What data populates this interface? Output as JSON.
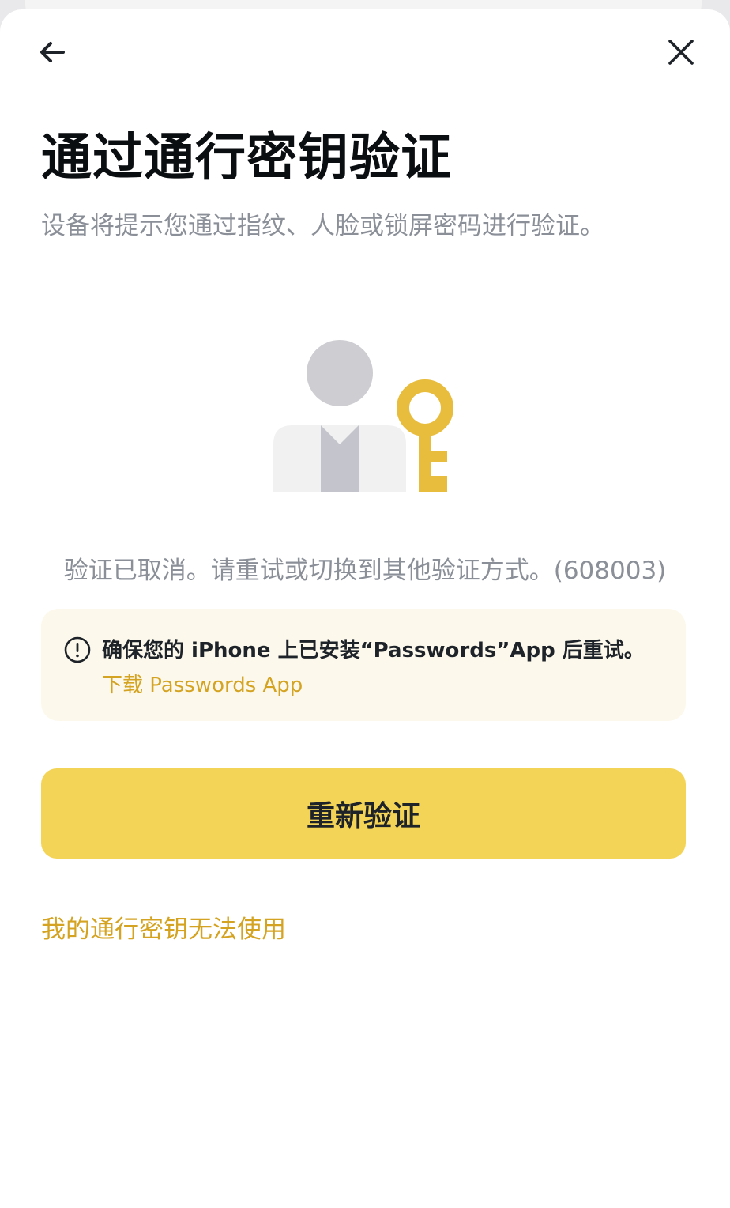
{
  "header": {
    "back_icon": "arrow-left-icon",
    "close_icon": "close-icon"
  },
  "title": "通过通行密钥验证",
  "subtitle": "设备将提示您通过指纹、人脸或锁屏密码进行验证。",
  "illustration": {
    "icon": "user-with-key-illustration",
    "colors": {
      "head": "#cdcdd2",
      "body": "#f1f1f2",
      "tie": "#c4c5cc",
      "key": "#e8bc3c"
    }
  },
  "status": {
    "message": "验证已取消。请重试或切换到其他验证方式。(608003)"
  },
  "notice": {
    "icon": "exclamation-circle-icon",
    "text": "确保您的 iPhone 上已安装“Passwords”App 后重试。",
    "link_label": "下载 Passwords App",
    "background": "#fcf9ec",
    "link_color": "#d4a322"
  },
  "actions": {
    "retry_label": "重新验证",
    "retry_color": "#f4d456",
    "alt_link_label": "我的通行密钥无法使用",
    "alt_link_color": "#d4a322"
  }
}
